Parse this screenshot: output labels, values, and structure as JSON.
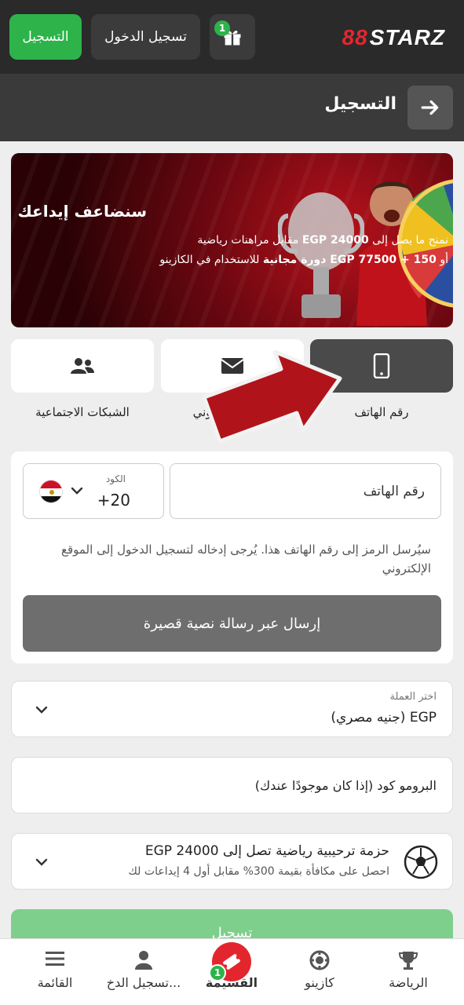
{
  "header": {
    "logo_text": "STARZ",
    "logo_mark": "88",
    "register_label": "التسجيل",
    "login_label": "تسجيل الدخول",
    "gift_badge": "1"
  },
  "titlebar": {
    "title": "التسجيل"
  },
  "banner": {
    "headline": "سنضاعف إيداعك",
    "line1_pre": "نمنح ما يصل إلى ",
    "line1_amount": "EGP 24000",
    "line1_post": " مقابل مراهنات رياضية",
    "line2_pre": "أو ",
    "line2_amount": "EGP 77500 + 150",
    "line2_bold": " دورة مجانية",
    "line2_post": " للاستخدام في الكازينو"
  },
  "tabs": [
    {
      "label": "رقم الهاتف",
      "icon": "phone-icon",
      "active": true
    },
    {
      "label": "البريد الإلكتروني",
      "icon": "envelope-icon",
      "active": false
    },
    {
      "label": "الشبكات الاجتماعية",
      "icon": "users-icon",
      "active": false
    }
  ],
  "phone_form": {
    "code_label": "الكود",
    "code_value": "+20",
    "phone_placeholder": "رقم الهاتف",
    "info_text": "سيُرسل الرمز إلى رقم الهاتف هذا. يُرجى إدخاله لتسجيل الدخول إلى الموقع الإلكتروني",
    "sms_button": "إرسال عبر رسالة نصية قصيرة"
  },
  "currency": {
    "label": "اختر العملة",
    "value": "EGP  (جنيه مصري)"
  },
  "promo": {
    "placeholder": "البرومو كود (إذا كان موجودًا عندك)"
  },
  "bonus": {
    "title": "حزمة ترحيبية رياضية تصل إلى EGP 24000",
    "subtitle": "احصل على مكافأة بقيمة 300% مقابل أول 4 إيداعات لك"
  },
  "register_button": "تسجيل",
  "bottom_nav": {
    "menu": "القائمة",
    "login": "تسجيل الدخ...",
    "coupon": "القسيمة",
    "coupon_badge": "1",
    "casino": "كازينو",
    "sports": "الرياضة"
  },
  "colors": {
    "accent_green": "#2db34a",
    "brand_red": "#e3262e",
    "dark_header": "#2a2a2a"
  }
}
